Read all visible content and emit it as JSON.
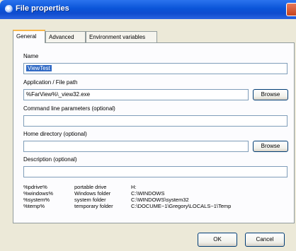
{
  "window": {
    "title": "File properties"
  },
  "tabs": [
    "General",
    "Advanced",
    "Environment variables"
  ],
  "fields": {
    "name": {
      "label": "Name",
      "value": "ViewTest"
    },
    "app_path": {
      "label": "Application / File path",
      "value": "%FarView%\\_view32.exe",
      "browse": "Browse"
    },
    "cmd_params": {
      "label": "Command line parameters (optional)",
      "value": ""
    },
    "home_dir": {
      "label": "Home directory (optional)",
      "value": "",
      "browse": "Browse"
    },
    "description": {
      "label": "Description (optional)",
      "value": ""
    }
  },
  "variables": [
    {
      "name": "%pdrive%",
      "desc": "portable drive",
      "value": "H:"
    },
    {
      "name": "%windows%",
      "desc": "Windows folder",
      "value": "C:\\WINDOWS"
    },
    {
      "name": "%system%",
      "desc": "system folder",
      "value": "C:\\WINDOWS\\system32"
    },
    {
      "name": "%temp%",
      "desc": "temporary folder",
      "value": "C:\\DOCUME~1\\Gregory\\LOCALS~1\\Temp"
    }
  ],
  "buttons": {
    "ok": "OK",
    "cancel": "Cancel"
  }
}
